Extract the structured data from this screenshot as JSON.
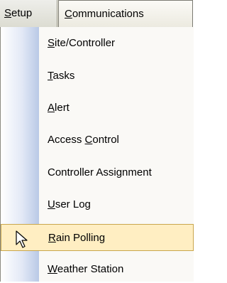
{
  "menubar": {
    "setup": {
      "pre": "",
      "ul": "S",
      "post": "etup"
    },
    "communications": {
      "pre": "",
      "ul": "C",
      "post": "ommunications"
    }
  },
  "menu": {
    "items": [
      {
        "pre": "",
        "ul": "S",
        "post": "ite/Controller"
      },
      {
        "pre": "",
        "ul": "T",
        "post": "asks"
      },
      {
        "pre": "",
        "ul": "A",
        "post": "lert"
      },
      {
        "pre": "Access ",
        "ul": "C",
        "post": "ontrol"
      },
      {
        "pre": "",
        "ul": "",
        "post": "Controller Assignment"
      },
      {
        "pre": "",
        "ul": "U",
        "post": "ser Log"
      },
      {
        "pre": "",
        "ul": "R",
        "post": "ain Polling"
      },
      {
        "pre": "",
        "ul": "W",
        "post": "eather Station"
      }
    ],
    "highlighted_index": 6
  },
  "cursor_icon": "mouse-pointer-icon",
  "colors": {
    "highlight_bg": "#ffeec2",
    "highlight_border": "#c9a64c",
    "gutter": "#b9c9e6"
  }
}
